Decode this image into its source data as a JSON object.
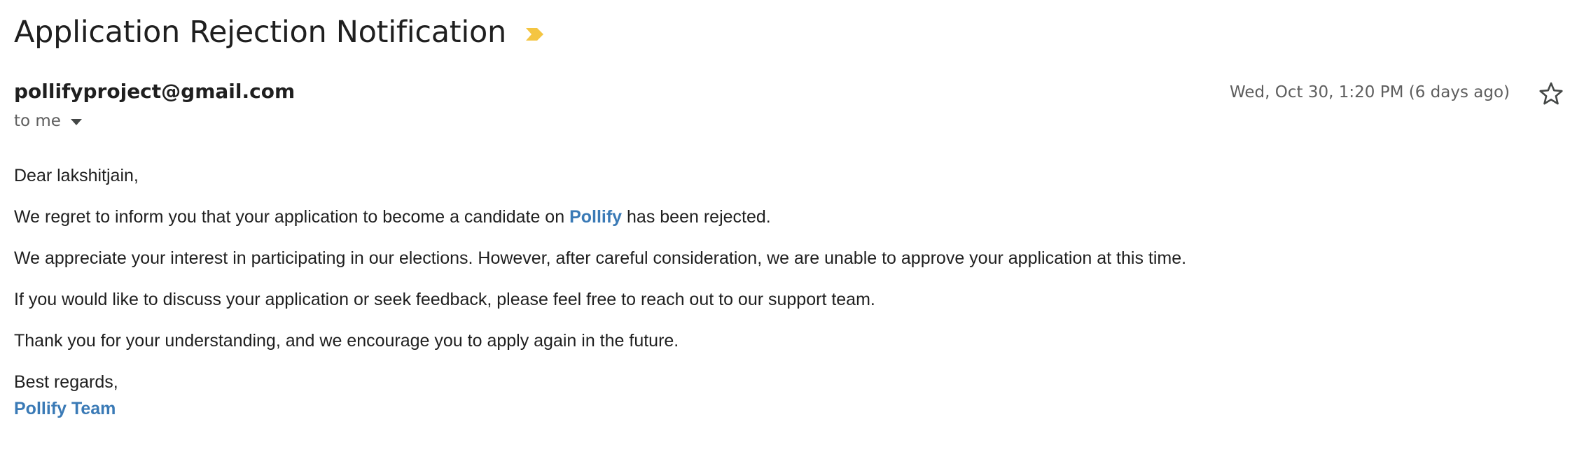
{
  "email": {
    "subject": "Application Rejection Notification",
    "sender": "pollifyproject@gmail.com",
    "recipient_label": "to me",
    "timestamp": "Wed, Oct 30, 1:20 PM (6 days ago)",
    "body": {
      "greeting": "Dear lakshitjain,",
      "p1_before": "We regret to inform you that your application to become a candidate on ",
      "p1_brand": "Pollify",
      "p1_after": " has been rejected.",
      "p2": "We appreciate your interest in participating in our elections. However, after careful consideration, we are unable to approve your application at this time.",
      "p3": "If you would like to discuss your application or seek feedback, please feel free to reach out to our support team.",
      "p4": "Thank you for your understanding, and we encourage you to apply again in the future.",
      "closing": "Best regards,",
      "signature": "Pollify Team"
    }
  },
  "icons": {
    "importance": "importance-marker-icon",
    "recipient_toggle": "chevron-down-icon",
    "star": "star-icon"
  },
  "colors": {
    "brand": "#3a7ab6",
    "importance": "#f4c542",
    "text": "#1f1f1f",
    "muted": "#5e5e5e"
  }
}
